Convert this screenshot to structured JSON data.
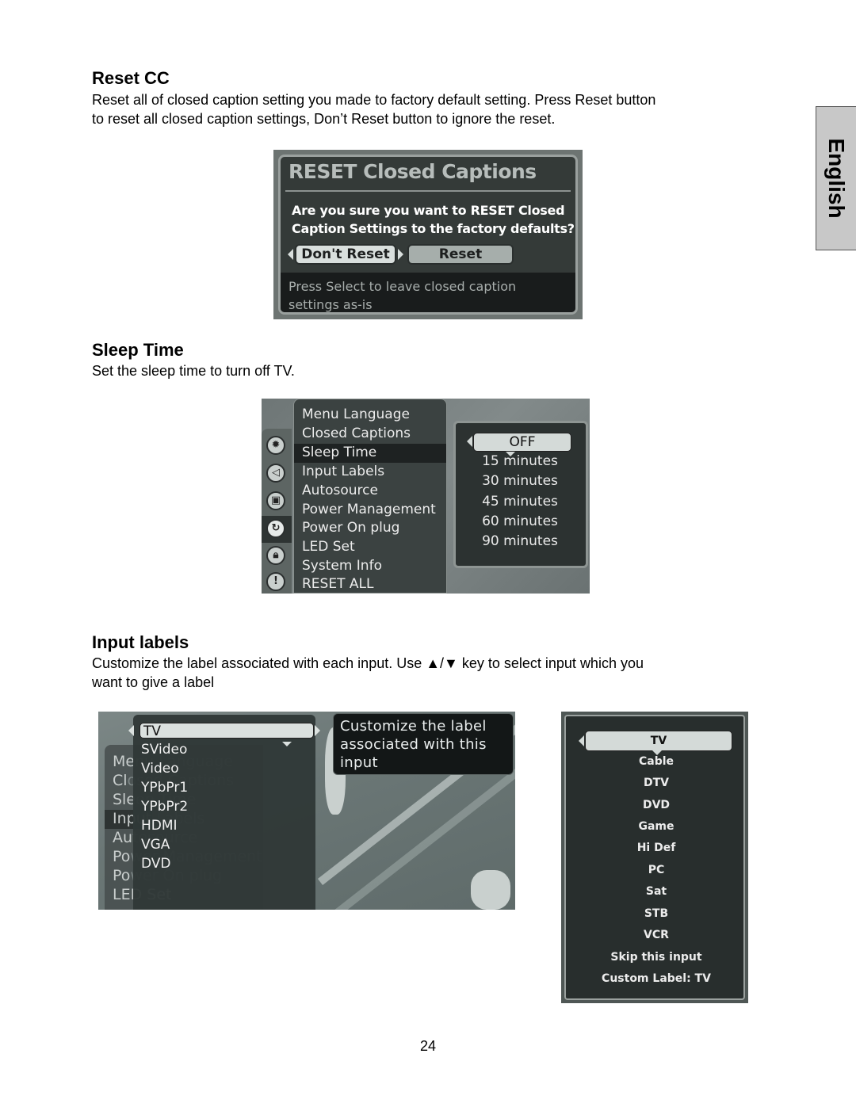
{
  "page": {
    "language_tab": "English",
    "page_number": "24"
  },
  "reset_cc": {
    "heading": "Reset CC",
    "description_line1": "Reset all of closed caption setting you made to factory default setting. Press Reset button",
    "description_line2": "to reset all closed caption settings, Don’t Reset button to ignore the reset.",
    "dialog": {
      "title": "RESET Closed Captions",
      "question_line1": "Are you sure you want to RESET Closed",
      "question_line2": "Caption Settings to the factory defaults?",
      "dont_reset_label": "Don't Reset",
      "reset_label": "Reset",
      "hint_line1": "Press Select to leave closed caption",
      "hint_line2": "settings as-is"
    }
  },
  "sleep_time": {
    "heading": "Sleep Time",
    "description": "Set the sleep time to turn off TV.",
    "menu_items": [
      "Menu Language",
      "Closed Captions",
      "Sleep Time",
      "Input Labels",
      "Autosource",
      "Power Management",
      "Power On plug",
      "LED Set",
      "System Info",
      "RESET ALL"
    ],
    "selected_menu_item": "Sleep Time",
    "side_icons": [
      "picture-icon",
      "audio-icon",
      "tv-icon",
      "setup-icon",
      "lock-icon",
      "help-icon"
    ],
    "options": {
      "selected": "OFF",
      "list": [
        "15 minutes",
        "30 minutes",
        "45 minutes",
        "60 minutes",
        "90 minutes"
      ]
    }
  },
  "input_labels": {
    "heading": "Input labels",
    "description_line1": "Customize the label associated with each input. Use ▲/▼ key to select input which you",
    "description_line2": "want to give a label",
    "left_screen": {
      "background_menu": [
        "Me",
        "Cl",
        "Sle",
        "Inp",
        "Au",
        "Po",
        "Po",
        "LED Set"
      ],
      "background_menu_faded": [
        "nu Language",
        "osed Captions",
        "ep Time",
        "ut Labels",
        "tosource",
        "wer Management",
        "wer On plug",
        ""
      ],
      "selected_input": "TV",
      "inputs": [
        "SVideo",
        "Video",
        "YPbPr1",
        "YPbPr2",
        "HDMI",
        "VGA",
        "DVD"
      ],
      "tooltip_line1": "Customize the label",
      "tooltip_line2": "associated with this",
      "tooltip_line3": "input"
    },
    "right_screen": {
      "selected_label": "TV",
      "labels": [
        "Cable",
        "DTV",
        "DVD",
        "Game",
        "Hi Def",
        "PC",
        "Sat",
        "STB",
        "VCR",
        "Skip this input",
        "Custom Label: TV"
      ]
    }
  }
}
